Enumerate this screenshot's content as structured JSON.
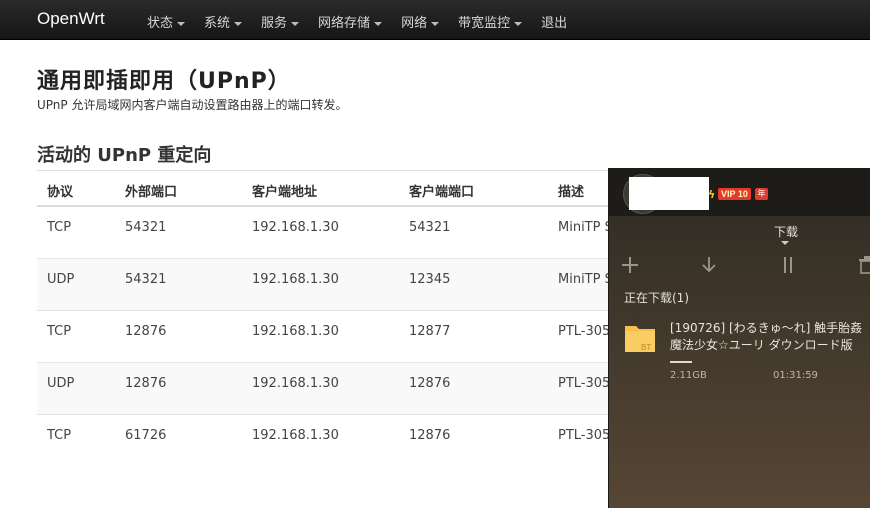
{
  "navbar": {
    "brand": "OpenWrt",
    "items": [
      {
        "label": "状态",
        "dropdown": true
      },
      {
        "label": "系统",
        "dropdown": true
      },
      {
        "label": "服务",
        "dropdown": true
      },
      {
        "label": "网络存储",
        "dropdown": true
      },
      {
        "label": "网络",
        "dropdown": true
      },
      {
        "label": "带宽监控",
        "dropdown": true
      },
      {
        "label": "退出",
        "dropdown": false
      }
    ]
  },
  "page": {
    "title": "通用即插即用（UPnP）",
    "description": "UPnP 允许局域网内客户端自动设置路由器上的端口转发。",
    "section_title": "活动的 UPnP 重定向"
  },
  "table": {
    "headers": [
      "协议",
      "外部端口",
      "客户端地址",
      "客户端端口",
      "描述"
    ],
    "rows": [
      [
        "TCP",
        "54321",
        "192.168.1.30",
        "54321",
        "MiniTP S"
      ],
      [
        "UDP",
        "54321",
        "192.168.1.30",
        "12345",
        "MiniTP S"
      ],
      [
        "TCP",
        "12876",
        "192.168.1.30",
        "12877",
        "PTL-305/"
      ],
      [
        "UDP",
        "12876",
        "192.168.1.30",
        "12876",
        "PTL-305/"
      ],
      [
        "TCP",
        "61726",
        "192.168.1.30",
        "12876",
        "PTL-305/"
      ]
    ]
  },
  "overlay": {
    "vip_label": "VIP 10",
    "year_label": "年",
    "tab_label": "下载",
    "status": "正在下载(1)",
    "download": {
      "name_line1": "[190726] [わるきゅ～れ] 触手胎姦",
      "name_line2": "魔法少女☆ユーリ ダウンロード版",
      "badge": "BT",
      "size": "2.11GB",
      "time": "01:31:59",
      "progress": 0.04
    },
    "icons": [
      "plus-icon",
      "download-icon",
      "pause-icon",
      "trash-icon"
    ]
  },
  "colors": {
    "navbar_bg": "#1b1b1b",
    "overlay_bg": "#3a3328",
    "vip_red": "#e4392b",
    "folder_yellow": "#f6c04a"
  }
}
